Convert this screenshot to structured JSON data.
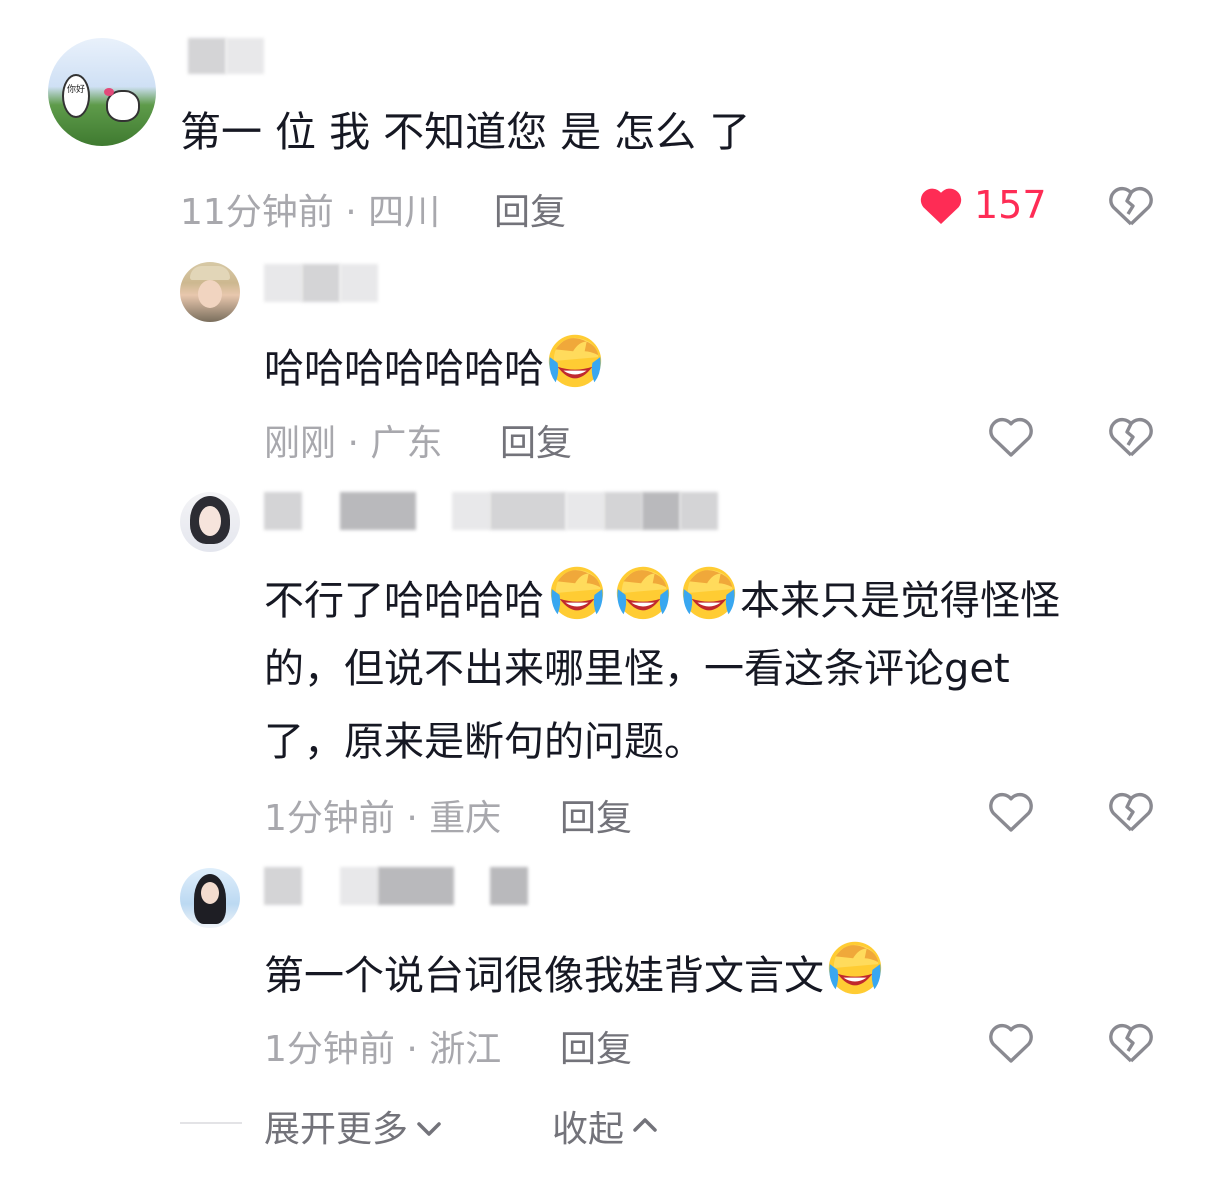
{
  "comments": [
    {
      "text": "第一 位 我 不知道您 是 怎么 了",
      "time": "11分钟前",
      "location": "四川",
      "reply": "回复",
      "likes": "157",
      "liked": true,
      "avatar_bubble": "你好"
    },
    {
      "text": "哈哈哈哈哈哈哈",
      "time": "刚刚",
      "location": "广东",
      "reply": "回复"
    },
    {
      "lines": [
        "不行了哈哈哈哈",
        "本来只是觉得怪怪",
        "的，但说不出来哪里怪，一看这条评论get",
        "了，原来是断句的问题。"
      ],
      "time": "1分钟前",
      "location": "重庆",
      "reply": "回复"
    },
    {
      "text": "第一个说台词很像我娃背文言文",
      "time": "1分钟前",
      "location": "浙江",
      "reply": "回复"
    }
  ],
  "sep": " · ",
  "footer": {
    "expand": "展开更多",
    "collapse": "收起"
  },
  "colors": {
    "like": "#fe2c55",
    "meta": "#a8a8ad",
    "text": "#161823"
  },
  "icons": [
    "heart-filled-icon",
    "heart-outline-icon",
    "broken-heart-icon",
    "laughing-crying-emoji",
    "chevron-down-icon",
    "chevron-up-icon"
  ]
}
